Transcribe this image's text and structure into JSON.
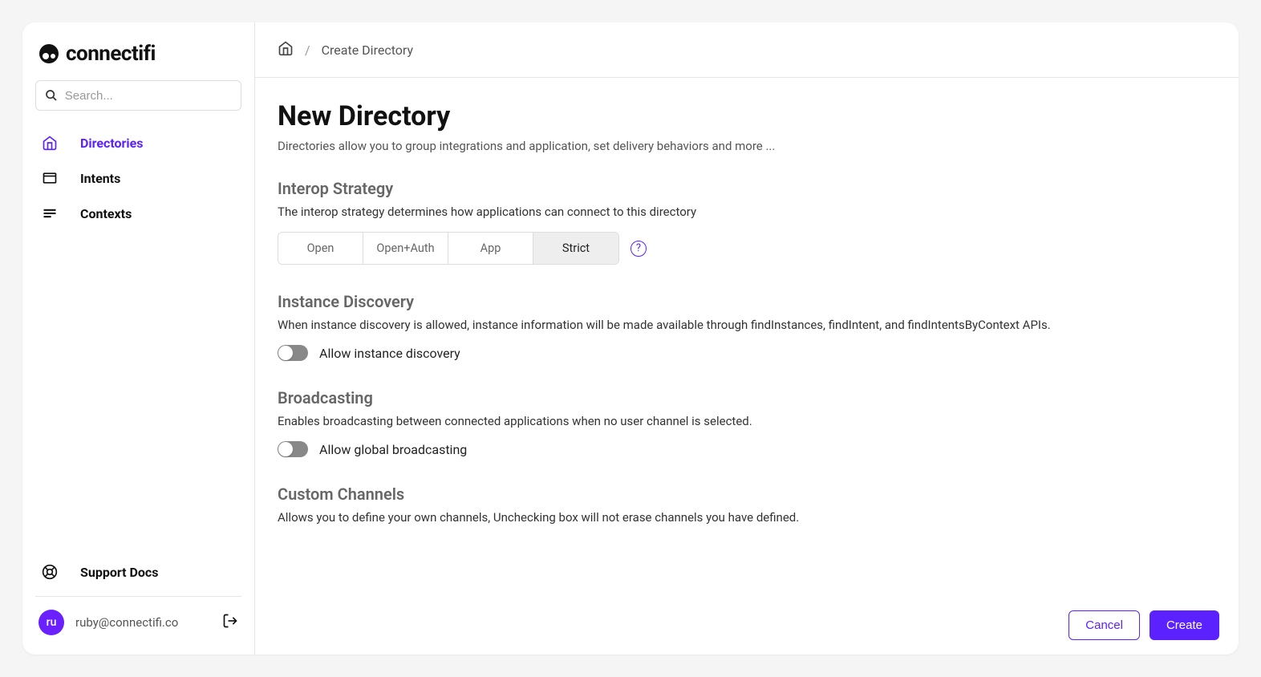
{
  "brand": {
    "name": "connectifi"
  },
  "search": {
    "placeholder": "Search..."
  },
  "sidebar": {
    "items": [
      {
        "label": "Directories",
        "active": true
      },
      {
        "label": "Intents",
        "active": false
      },
      {
        "label": "Contexts",
        "active": false
      }
    ],
    "support": "Support Docs"
  },
  "user": {
    "initials": "ru",
    "email": "ruby@connectifi.co"
  },
  "breadcrumb": {
    "current": "Create Directory"
  },
  "page": {
    "title": "New Directory",
    "subtitle": "Directories allow you to group integrations and application, set delivery behaviors and more ..."
  },
  "sections": {
    "interop": {
      "title": "Interop Strategy",
      "desc": "The interop strategy determines how applications can connect to this directory",
      "options": [
        "Open",
        "Open+Auth",
        "App",
        "Strict"
      ],
      "selected": "Strict"
    },
    "discovery": {
      "title": "Instance Discovery",
      "desc": "When instance discovery is allowed, instance information will be made available through findInstances, findIntent, and findIntentsByContext APIs.",
      "toggle_label": "Allow instance discovery",
      "toggle_on": false
    },
    "broadcasting": {
      "title": "Broadcasting",
      "desc": "Enables broadcasting between connected applications when no user channel is selected.",
      "toggle_label": "Allow global broadcasting",
      "toggle_on": false
    },
    "channels": {
      "title": "Custom Channels",
      "desc": "Allows you to define your own channels, Unchecking box will not erase channels you have defined."
    }
  },
  "footer": {
    "cancel": "Cancel",
    "create": "Create"
  }
}
